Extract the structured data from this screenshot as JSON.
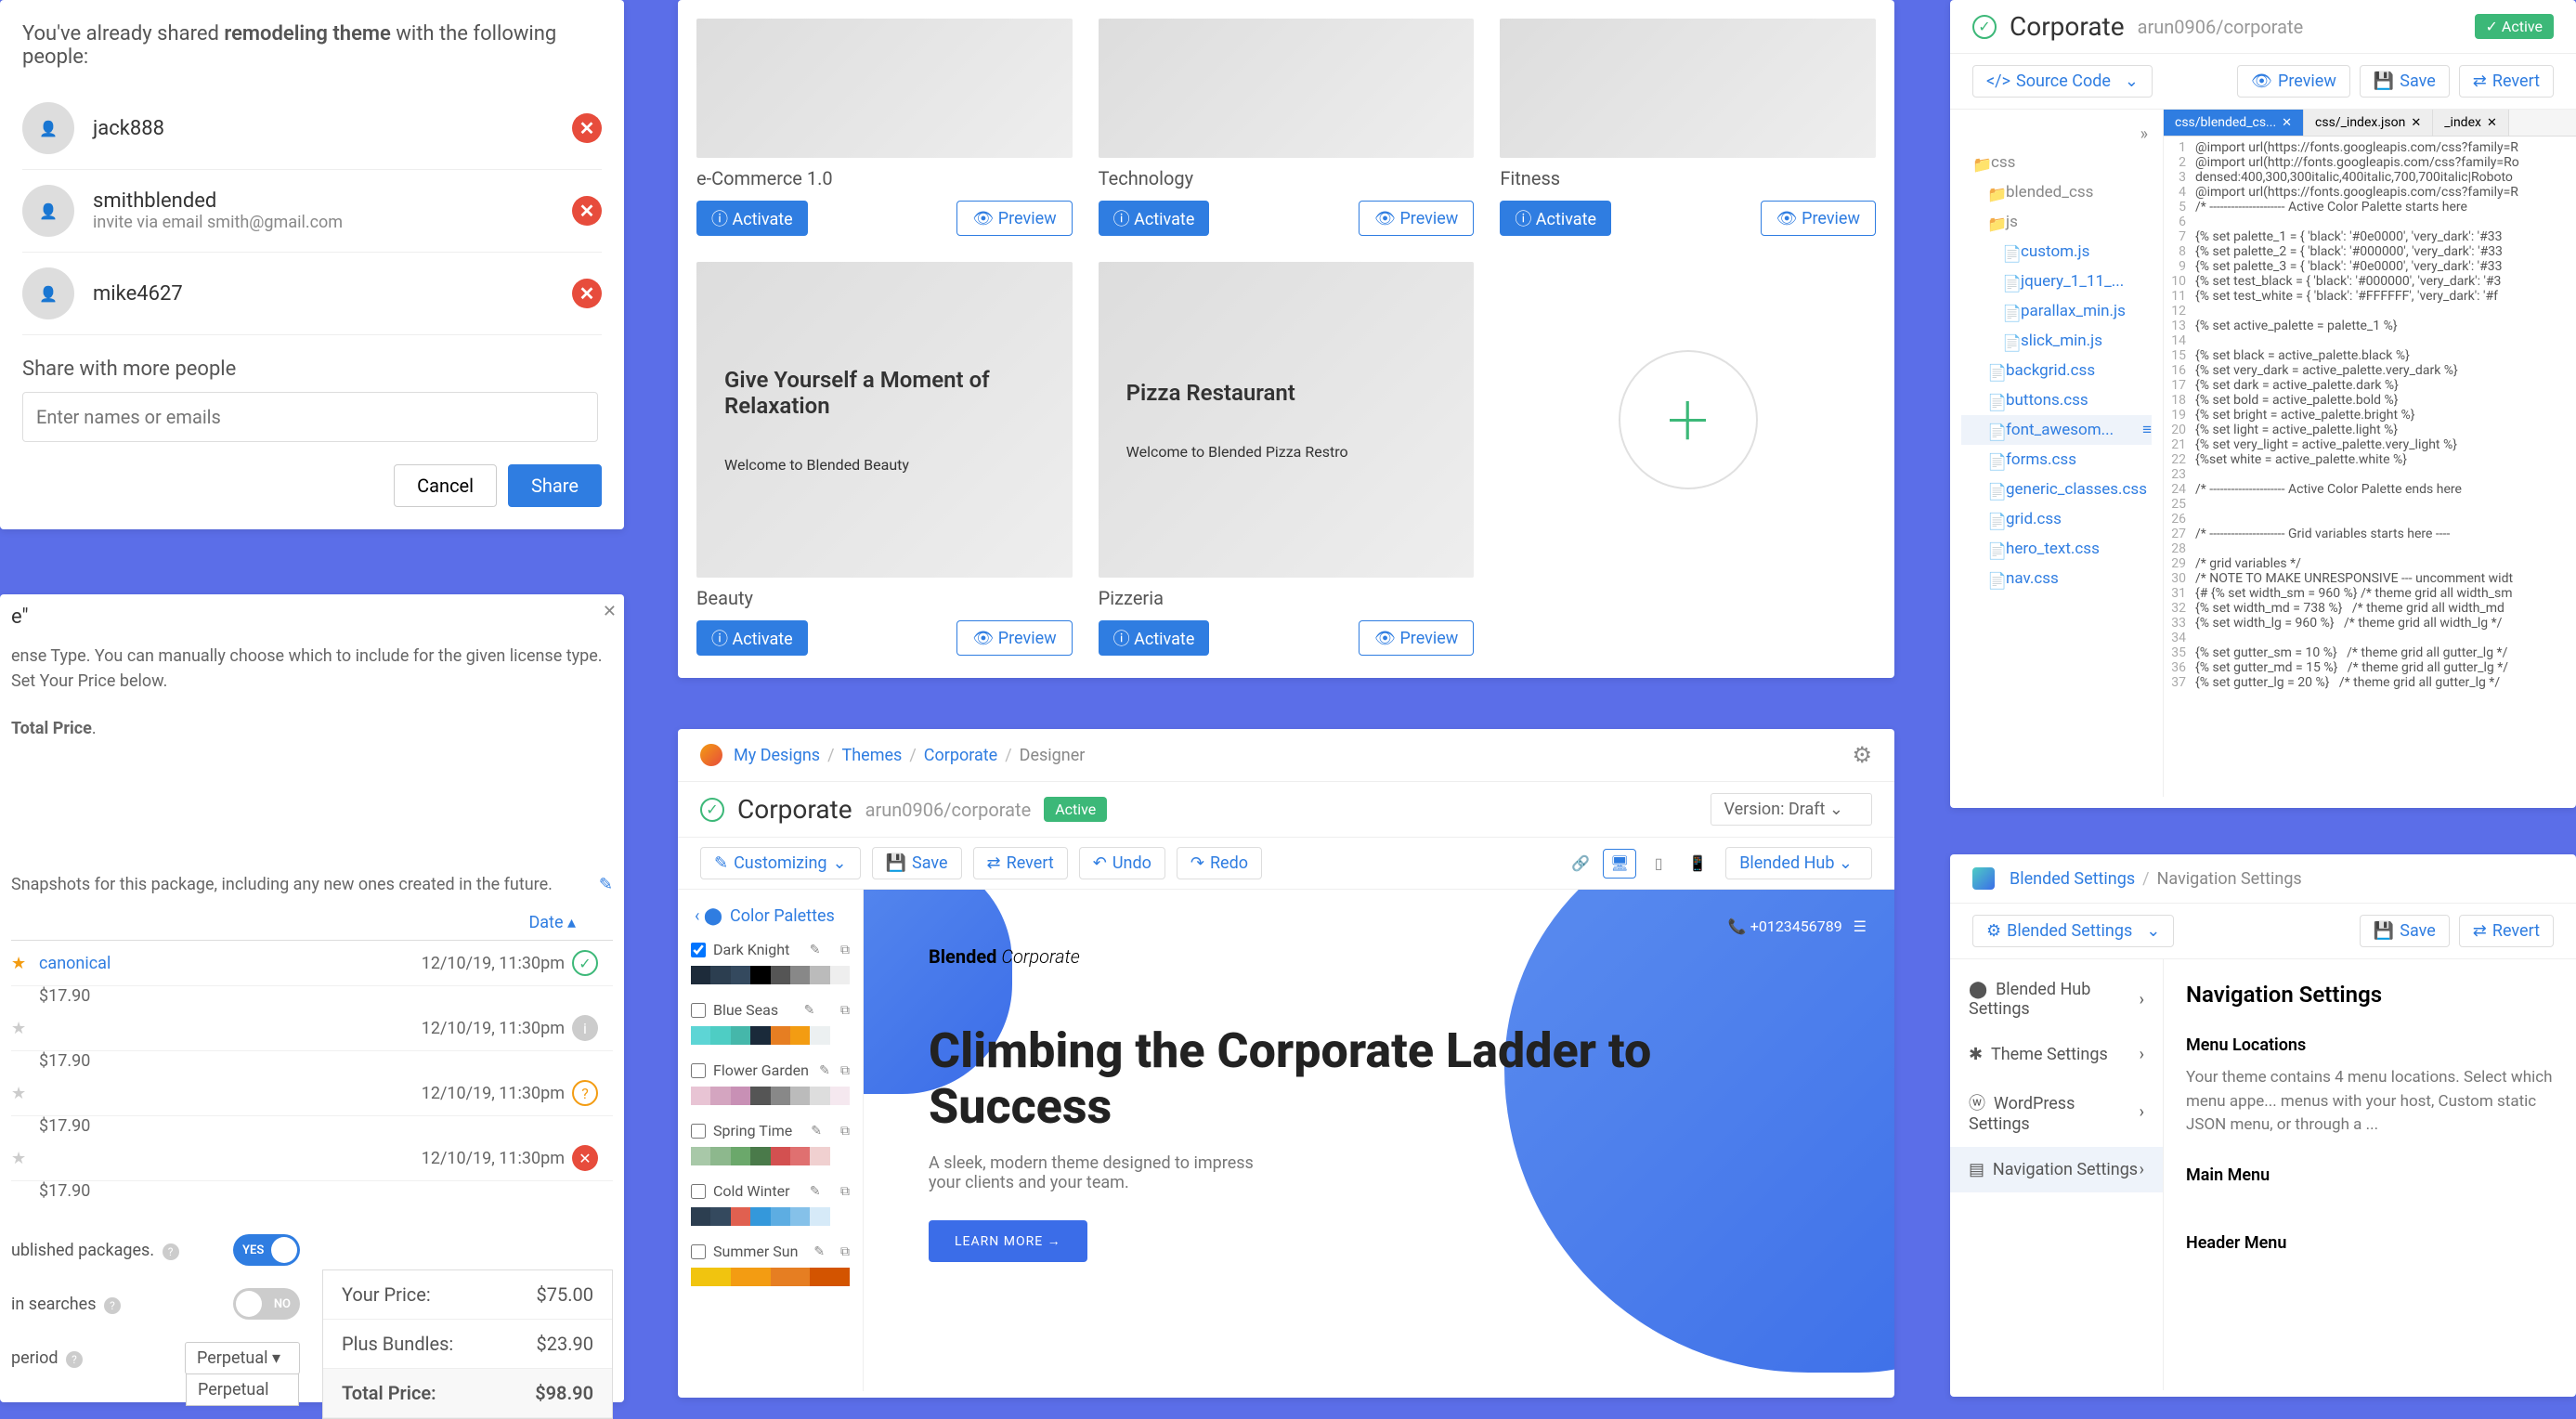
{
  "share": {
    "intro_prefix": "You've already shared ",
    "intro_bold": "remodeling theme",
    "intro_suffix": " with the following people:",
    "users": [
      {
        "name": "jack888",
        "email": ""
      },
      {
        "name": "smithblended",
        "email": "invite via email smith@gmail.com"
      },
      {
        "name": "mike4627",
        "email": ""
      }
    ],
    "more_label": "Share with more people",
    "input_placeholder": "Enter names or emails",
    "cancel": "Cancel",
    "share_btn": "Share"
  },
  "package": {
    "license_text": "ense Type. You can manually choose which to include for the given license type. Set Your Price below.",
    "total_label": "Total Price",
    "snapshots_note": "Snapshots for this package, including any new ones created in the future.",
    "date_col": "Date ▴",
    "rows": [
      {
        "name": "canonical",
        "starred": true,
        "price": "$17.90",
        "date": "12/10/19, 11:30pm",
        "status": "ok"
      },
      {
        "name": "",
        "starred": false,
        "price": "$17.90",
        "date": "12/10/19, 11:30pm",
        "status": "info"
      },
      {
        "name": "",
        "starred": false,
        "price": "$17.90",
        "date": "12/10/19, 11:30pm",
        "status": "warn"
      },
      {
        "name": "",
        "starred": false,
        "price": "$17.90",
        "date": "12/10/19, 11:30pm",
        "status": "del"
      }
    ],
    "prices": {
      "your_label": "Your Price:",
      "your_val": "$75.00",
      "plus_label": "Plus Bundles:",
      "plus_val": "$23.90",
      "total_label": "Total Price:",
      "total_val": "$98.90"
    },
    "toggles": {
      "published": "ublished packages.",
      "yes": "YES",
      "searches": " in searches",
      "no": "NO",
      "period": "period"
    },
    "select_val": "Perpetual",
    "select_opt": "Perpetual"
  },
  "gallery": {
    "templates_top": [
      {
        "name": "e-Commerce 1.0"
      },
      {
        "name": "Technology"
      },
      {
        "name": "Fitness"
      }
    ],
    "templates_bottom": [
      {
        "name": "Beauty",
        "headline": "Give Yourself a Moment of Relaxation",
        "sub": "Welcome to Blended Beauty"
      },
      {
        "name": "Pizzeria",
        "headline": "Pizza Restaurant",
        "sub": "Welcome to Blended Pizza Restro"
      }
    ],
    "activate": "Activate",
    "preview": "Preview"
  },
  "designer": {
    "crumbs": [
      "My Designs",
      "Themes",
      "Corporate",
      "Designer"
    ],
    "title": "Corporate",
    "slug": "arun0906/corporate",
    "active": "Active",
    "version": "Version: Draft",
    "customizing": "Customizing",
    "save": "Save",
    "revert": "Revert",
    "undo": "Undo",
    "redo": "Redo",
    "hub": "Blended Hub",
    "palettes_label": "Color Palettes",
    "palettes": [
      {
        "name": "Dark Knight",
        "checked": true,
        "colors": [
          "#1d2b3a",
          "#2c3e50",
          "#34495e",
          "#000",
          "#555",
          "#888",
          "#bbb",
          "#eee"
        ]
      },
      {
        "name": "Blue Seas",
        "checked": false,
        "colors": [
          "#5dd5d5",
          "#4ecdc4",
          "#45b7aa",
          "#1a2a3a",
          "#e67e22",
          "#f39c12",
          "#ecf0f1",
          "#fff"
        ]
      },
      {
        "name": "Flower Garden",
        "checked": false,
        "colors": [
          "#e8c4d4",
          "#d4a5c0",
          "#c890b5",
          "#555",
          "#888",
          "#bbb",
          "#ddd",
          "#f5e8ef"
        ]
      },
      {
        "name": "Spring Time",
        "checked": false,
        "colors": [
          "#a8c8a8",
          "#8db88d",
          "#6ba86b",
          "#4a7a4a",
          "#d35050",
          "#e07070",
          "#f0d0d0",
          "#fff"
        ]
      },
      {
        "name": "Cold Winter",
        "checked": false,
        "colors": [
          "#2c3e50",
          "#34495e",
          "#e06050",
          "#3498db",
          "#5dade2",
          "#85c1e9",
          "#d6eaf8",
          "#fff"
        ]
      },
      {
        "name": "Summer Sun",
        "checked": false,
        "colors": [
          "#f1c40f",
          "#f39c12",
          "#e67e22",
          "#d35400"
        ]
      }
    ],
    "hero": {
      "brand_bold": "Blended",
      "brand_italic": "Corporate",
      "phone": "+0123456789",
      "h1": "Climbing the Corporate Ladder to Success",
      "p": "A sleek, modern theme designed to impress your clients and your team.",
      "cta": "LEARN MORE →"
    }
  },
  "source": {
    "title": "Corporate",
    "slug": "arun0906/corporate",
    "active": "Active",
    "dropdown": "Source Code",
    "preview": "Preview",
    "save": "Save",
    "revert": "Revert",
    "tabs": [
      {
        "name": "css/blended_cs...",
        "active": true
      },
      {
        "name": "css/_index.json",
        "active": false
      },
      {
        "name": "_index",
        "active": false
      }
    ],
    "tree": [
      {
        "label": "css",
        "type": "folder",
        "depth": 0
      },
      {
        "label": "blended_css",
        "type": "folder",
        "depth": 1
      },
      {
        "label": "js",
        "type": "folder",
        "depth": 1
      },
      {
        "label": "custom.js",
        "type": "file",
        "depth": 2
      },
      {
        "label": "jquery_1_11_...",
        "type": "file",
        "depth": 2
      },
      {
        "label": "parallax_min.js",
        "type": "file",
        "depth": 2
      },
      {
        "label": "slick_min.js",
        "type": "file",
        "depth": 2
      },
      {
        "label": "backgrid.css",
        "type": "file",
        "depth": 1
      },
      {
        "label": "buttons.css",
        "type": "file",
        "depth": 1
      },
      {
        "label": "font_awesom...",
        "type": "file",
        "depth": 1,
        "sel": true
      },
      {
        "label": "forms.css",
        "type": "file",
        "depth": 1
      },
      {
        "label": "generic_classes.css",
        "type": "file",
        "depth": 1
      },
      {
        "label": "grid.css",
        "type": "file",
        "depth": 1
      },
      {
        "label": "hero_text.css",
        "type": "file",
        "depth": 1
      },
      {
        "label": "nav.css",
        "type": "file",
        "depth": 1
      }
    ],
    "code": [
      "@import url(https://fonts.googleapis.com/css?family=R",
      "@import url(http://fonts.googleapis.com/css?family=Ro",
      "densed:400,300,300italic,400italic,700,700italic|Roboto",
      "@import url(https://fonts.googleapis.com/css?family=R",
      "/* --------------------- Active Color Palette starts here",
      "",
      "{% set palette_1 = { 'black': '#0e0000', 'very_dark': '#33",
      "{% set palette_2 = { 'black': '#000000', 'very_dark': '#33",
      "{% set palette_3 = { 'black': '#0e0000', 'very_dark': '#33",
      "{% set test_black = { 'black': '#000000', 'very_dark': '#3",
      "{% set test_white = { 'black': '#FFFFFF', 'very_dark': '#f",
      "",
      "{% set active_palette = palette_1 %}",
      "",
      "{% set black = active_palette.black %}",
      "{% set very_dark = active_palette.very_dark %}",
      "{% set dark = active_palette.dark %}",
      "{% set bold = active_palette.bold %}",
      "{% set bright = active_palette.bright %}",
      "{% set light = active_palette.light %}",
      "{% set very_light = active_palette.very_light %}",
      "{%set white = active_palette.white %}",
      "",
      "/* --------------------- Active Color Palette ends here",
      "",
      "",
      "/* --------------------- Grid variables starts here ----",
      "",
      "/* grid variables */",
      "/* NOTE TO MAKE UNRESPONSIVE --- uncomment widt",
      "{# {% set width_sm = 960 %} /* theme grid all width_sm",
      "{% set width_md = 738 %}   /* theme grid all width_md",
      "{% set width_lg = 960 %}   /* theme grid all width_lg */",
      "",
      "{% set gutter_sm = 10 %}   /* theme grid all gutter_lg */",
      "{% set gutter_md = 15 %}   /* theme grid all gutter_lg */",
      "{% set gutter_lg = 20 %}   /* theme grid all gutter_lg */"
    ]
  },
  "navsettings": {
    "crumbs": [
      "Blended Settings",
      "Navigation Settings"
    ],
    "dropdown": "Blended Settings",
    "save": "Save",
    "revert": "Revert",
    "menu": [
      "Blended Hub Settings",
      "Theme Settings",
      "WordPress Settings",
      "Navigation Settings"
    ],
    "h": "Navigation Settings",
    "loc_h": "Menu Locations",
    "loc_p": "Your theme contains 4 menu locations. Select which menu appe... menus with your host, Custom static JSON menu, or through a ...",
    "main_h": "Main Menu",
    "header_h": "Header Menu"
  }
}
